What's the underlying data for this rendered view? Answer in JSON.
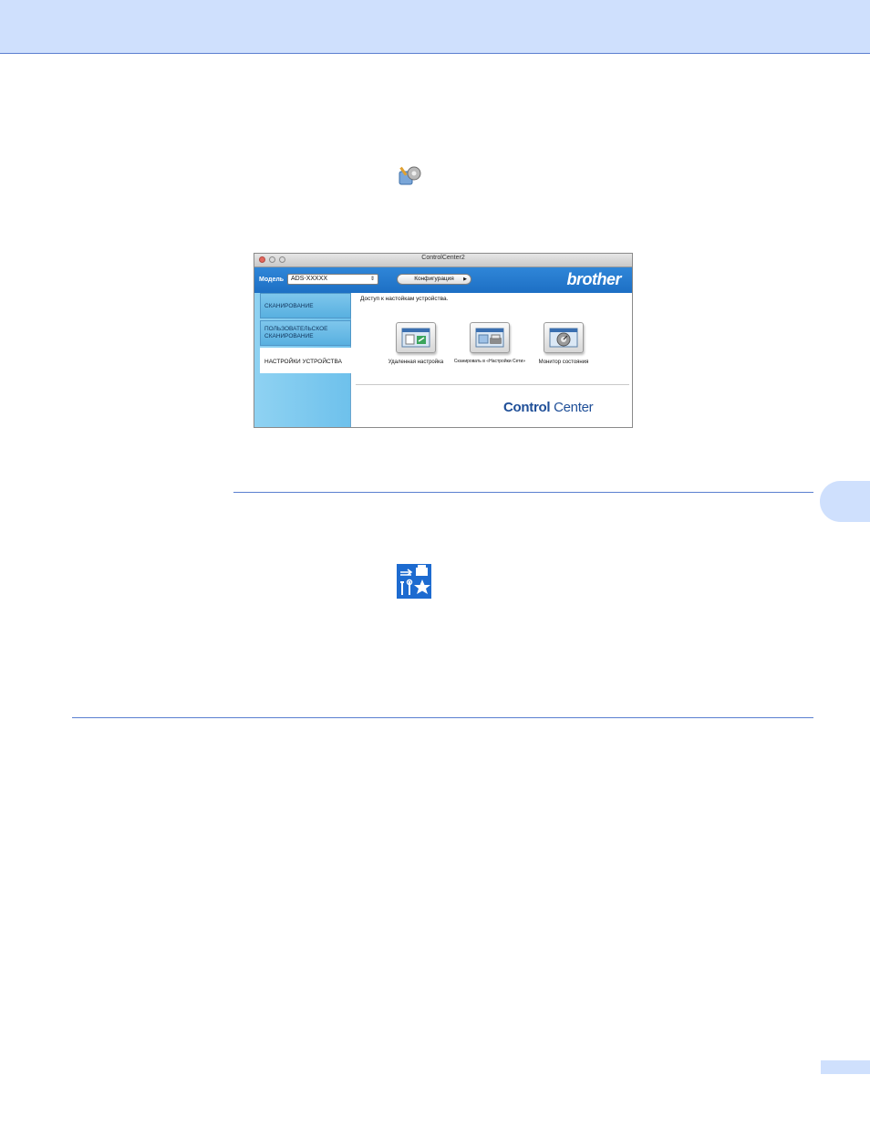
{
  "window": {
    "title": "ControlCenter2",
    "brand": "brother",
    "model_label": "Модель",
    "model_value": "ADS-XXXXX",
    "config_button": "Конфигурация"
  },
  "sidebar": {
    "items": [
      {
        "label": "СКАНИРОВАНИЕ"
      },
      {
        "label": "ПОЛЬЗОВАТЕЛЬСКОЕ СКАНИРОВАНИЕ"
      },
      {
        "label": "НАСТРОЙКИ УСТРОЙСТВА",
        "active": true
      }
    ]
  },
  "content": {
    "hint": "Доступ к настойкам устройства.",
    "tiles": [
      {
        "label": "Удаленная настройка",
        "icon": "remote-setup-icon"
      },
      {
        "label": "Сканировать в «Настройки Сети»",
        "icon": "scan-to-network-icon"
      },
      {
        "label": "Монитор состояния",
        "icon": "status-monitor-icon"
      }
    ],
    "logo_bold": "Control",
    "logo_regular": " Center"
  },
  "colors": {
    "header_band": "#cfe0fd",
    "rule": "#5b7fd0",
    "toolbar_blue": "#1d6fc4",
    "sidebar_blue": "#6ec1ec",
    "logo_blue": "#1f4f98",
    "device_icon_bg": "#1d6bd0"
  },
  "icons": {
    "inline_settings": "device-settings-gear-icon",
    "device_settings_button": "device-settings-tools-icon"
  }
}
